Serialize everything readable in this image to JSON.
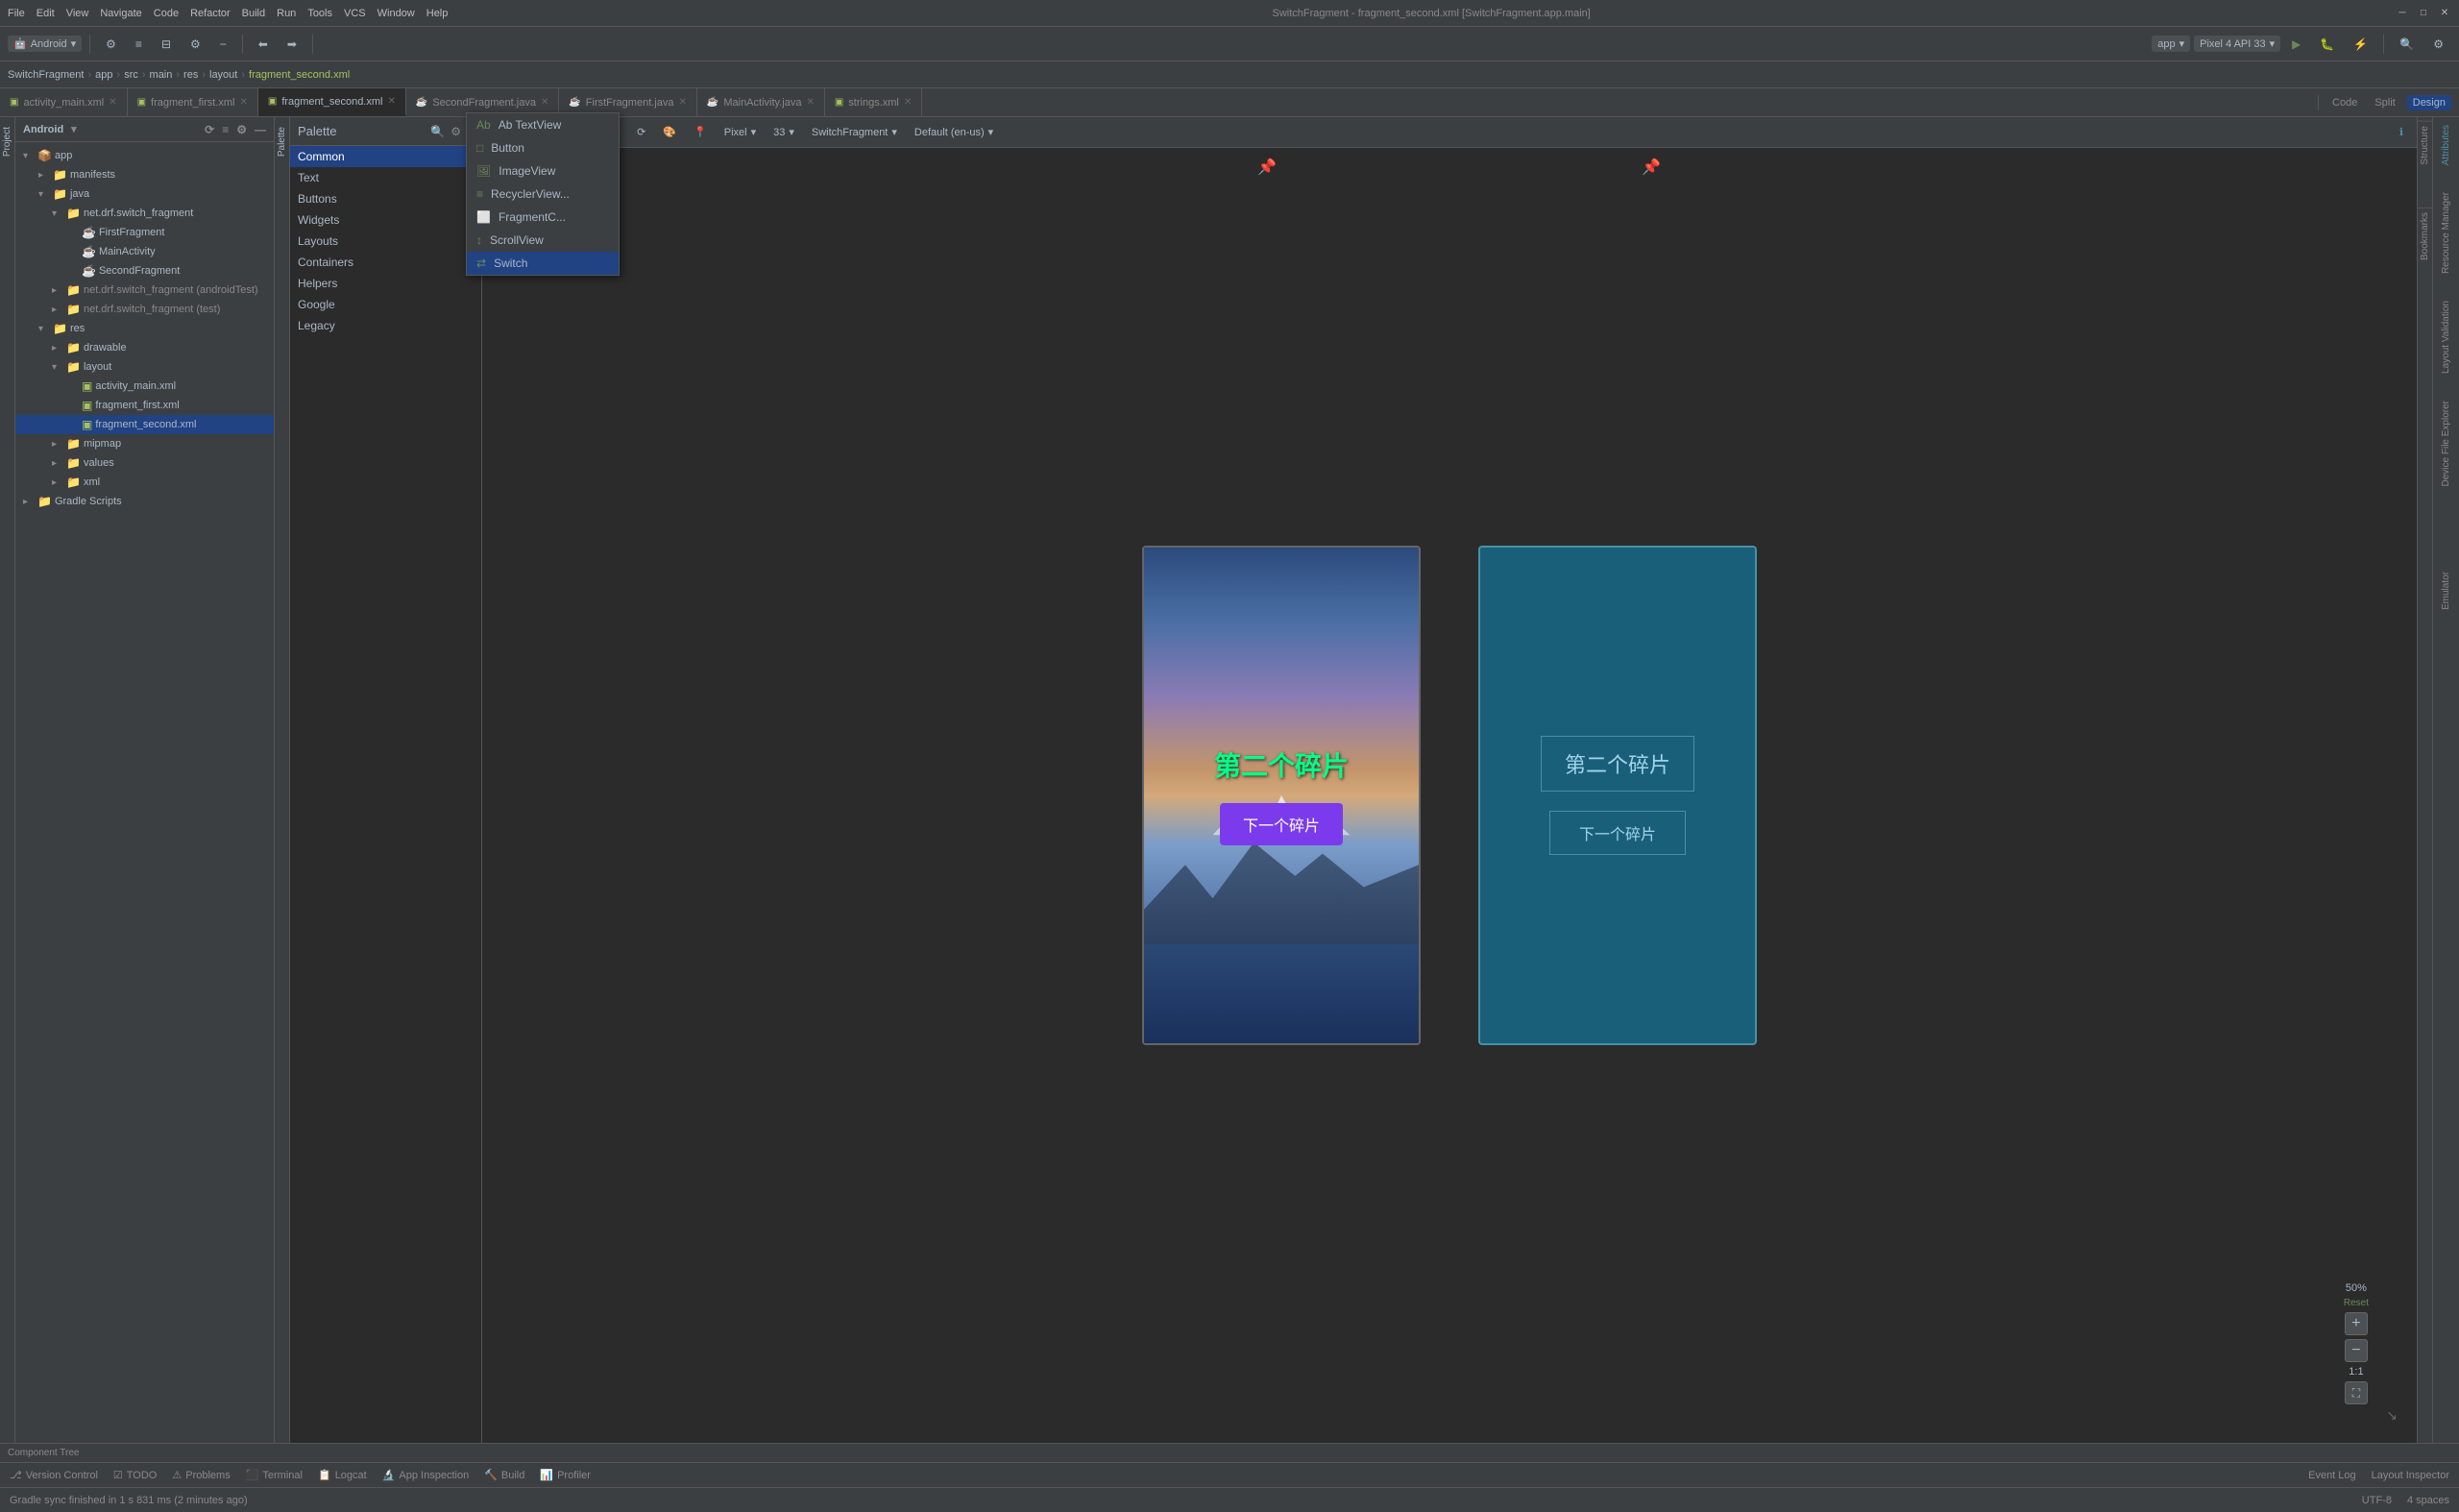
{
  "window": {
    "title": "SwitchFragment - fragment_second.xml [SwitchFragment.app.main]",
    "menu": [
      "File",
      "Edit",
      "View",
      "Navigate",
      "Code",
      "Refactor",
      "Build",
      "Run",
      "Tools",
      "VCS",
      "Window",
      "Help"
    ]
  },
  "toolbar": {
    "project_name": "SwitchFragment",
    "module": "app",
    "run_config": "app",
    "device": "Pixel 4 API 33",
    "flavour": "SwitchFragment"
  },
  "breadcrumb": {
    "items": [
      "SwitchFragment",
      "app",
      "src",
      "main",
      "res",
      "layout",
      "fragment_second.xml"
    ]
  },
  "tabs": [
    {
      "label": "activity_main.xml",
      "active": false,
      "closable": true
    },
    {
      "label": "fragment_first.xml",
      "active": false,
      "closable": true
    },
    {
      "label": "fragment_second.xml",
      "active": true,
      "closable": true
    },
    {
      "label": "SecondFragment.java",
      "active": false,
      "closable": true
    },
    {
      "label": "FirstFragment.java",
      "active": false,
      "closable": true
    },
    {
      "label": "MainActivity.java",
      "active": false,
      "closable": true
    },
    {
      "label": "strings.xml",
      "active": false,
      "closable": true
    }
  ],
  "view_tabs": [
    "Code",
    "Split",
    "Design"
  ],
  "active_view": "Design",
  "sidebar": {
    "title": "Android",
    "items": [
      {
        "label": "app",
        "type": "folder",
        "depth": 0,
        "expanded": true
      },
      {
        "label": "manifests",
        "type": "folder",
        "depth": 1,
        "expanded": false
      },
      {
        "label": "java",
        "type": "folder",
        "depth": 1,
        "expanded": true
      },
      {
        "label": "net.drf.switch_fragment",
        "type": "folder",
        "depth": 2,
        "expanded": true
      },
      {
        "label": "FirstFragment",
        "type": "java",
        "depth": 3
      },
      {
        "label": "MainActivity",
        "type": "java",
        "depth": 3
      },
      {
        "label": "SecondFragment",
        "type": "java",
        "depth": 3
      },
      {
        "label": "net.drf.switch_fragment (androidTest)",
        "type": "folder",
        "depth": 2,
        "expanded": false
      },
      {
        "label": "net.drf.switch_fragment (test)",
        "type": "folder",
        "depth": 2,
        "expanded": false
      },
      {
        "label": "res",
        "type": "folder",
        "depth": 1,
        "expanded": true
      },
      {
        "label": "drawable",
        "type": "folder",
        "depth": 2,
        "expanded": false
      },
      {
        "label": "layout",
        "type": "folder",
        "depth": 2,
        "expanded": true
      },
      {
        "label": "activity_main.xml",
        "type": "xml",
        "depth": 3
      },
      {
        "label": "fragment_first.xml",
        "type": "xml",
        "depth": 3
      },
      {
        "label": "fragment_second.xml",
        "type": "xml",
        "depth": 3,
        "selected": true
      },
      {
        "label": "mipmap",
        "type": "folder",
        "depth": 2,
        "expanded": false
      },
      {
        "label": "values",
        "type": "folder",
        "depth": 2,
        "expanded": false
      },
      {
        "label": "xml",
        "type": "folder",
        "depth": 2,
        "expanded": false
      },
      {
        "label": "Gradle Scripts",
        "type": "folder",
        "depth": 0,
        "expanded": false
      }
    ]
  },
  "palette": {
    "title": "Palette",
    "search_placeholder": "Search",
    "categories": [
      "Common",
      "Text",
      "Buttons",
      "Widgets",
      "Layouts",
      "Containers",
      "Helpers",
      "Google",
      "Legacy"
    ],
    "active_category": "Common",
    "dropdown_items": [
      {
        "label": "Ab TextView",
        "active": false
      },
      {
        "label": "Button",
        "active": false
      },
      {
        "label": "ImageView",
        "active": false
      },
      {
        "label": "RecyclerView...",
        "active": false
      },
      {
        "label": "FragmentC...",
        "active": false
      },
      {
        "label": "ScrollView",
        "active": false
      },
      {
        "label": "Switch",
        "active": true
      }
    ],
    "selected_item": "Switch"
  },
  "canvas": {
    "file_name": "fragment_second.xml",
    "device": "Pixel",
    "zoom": "33",
    "locale": "Default (en-us)",
    "activity": "SwitchFragment",
    "preview_title": "第二个碎片",
    "btn_label": "下一个碎片",
    "blueprint_title": "第二个碎片",
    "blueprint_btn": "下一个碎片"
  },
  "zoom": {
    "value": "50%",
    "reset_label": "Reset",
    "ratio_label": "1:1"
  },
  "right_tabs": [
    "Attributes",
    "Resource Manager",
    "Layout Validation",
    "Device File Explorer"
  ],
  "bottom_tabs": [
    "Version Control",
    "TODO",
    "Problems",
    "Terminal",
    "Logcat",
    "App Inspection",
    "Build",
    "Profiler"
  ],
  "status_bar": {
    "message": "Gradle sync finished in 1 s 831 ms (2 minutes ago)"
  },
  "right_actions": [
    "Event Log",
    "Layout Inspector"
  ],
  "component_tree_label": "Component Tree",
  "structure_label": "Structure",
  "bookmarks_label": "Bookmarks",
  "emulator_label": "Emulator"
}
